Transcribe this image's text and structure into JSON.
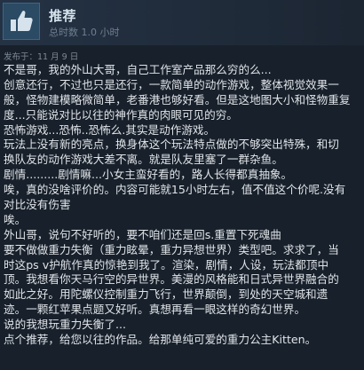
{
  "review": {
    "recommendation": "推荐",
    "hours": "总时数 1.0 小时",
    "posted": "发布于：11 月 9 日",
    "lines": [
      "不是哥，我的外山大哥，自己工作室产品那么穷的么...",
      "创意还行，不过也只是还行，一款简单的动作游戏，整体视觉效果一",
      "般，怪物建模略微简单，老番港也够好看。但是这地图大小和怪物重复",
      "度...只能说对比以往的神作真的肉眼可见的穷。",
      "恐怖游戏...恐怖..恐怖么.其实是动作游戏。",
      "玩法上没有新的亮点，换身体这个玩法特点做的不够突出特殊，和切",
      "换队友的动作游戏大差不离。就是队友里塞了一群杂鱼。",
      "剧情.........剧情嘛...小女主蛮好看的，路人长得都真抽象。",
      "唉，真的没啥评价的。内容可能就15小时左右，值不值这个价呢.没有",
      "对比没有伤害",
      "唉。",
      "外山哥，说句不好听的，要不咱们还是回s.重置下死魂曲",
      "要不做做重力失衡（重力眩晕，重力异想世界）类型吧。求求了，当",
      "时这ps v护航作真的惊艳到我了。渲染，剧情，人设，玩法都顶中",
      "顶。我想看你天马行空的异世界。美漫的风格能和日式异世界融合的",
      "如此之好。用陀螺仪控制重力飞行，世界颠倒，到处的天空城和遗",
      "迹。一颗红苹果点题又好听。真想再看一眼这样的奇幻世界。",
      "说的我想玩重力失衡了...",
      "点个推荐，给您以往的作品。给那单纯可爱的重力公主Kitten。"
    ]
  },
  "colors": {
    "background": "#18202b",
    "header": "#243244",
    "thumb_box": "#2b4a63",
    "thumb_icon": "#d6e3ec",
    "text": "#e0e4e8",
    "muted": "#7e8a96"
  },
  "icons": {
    "recommendation": "thumbs-up-icon"
  }
}
